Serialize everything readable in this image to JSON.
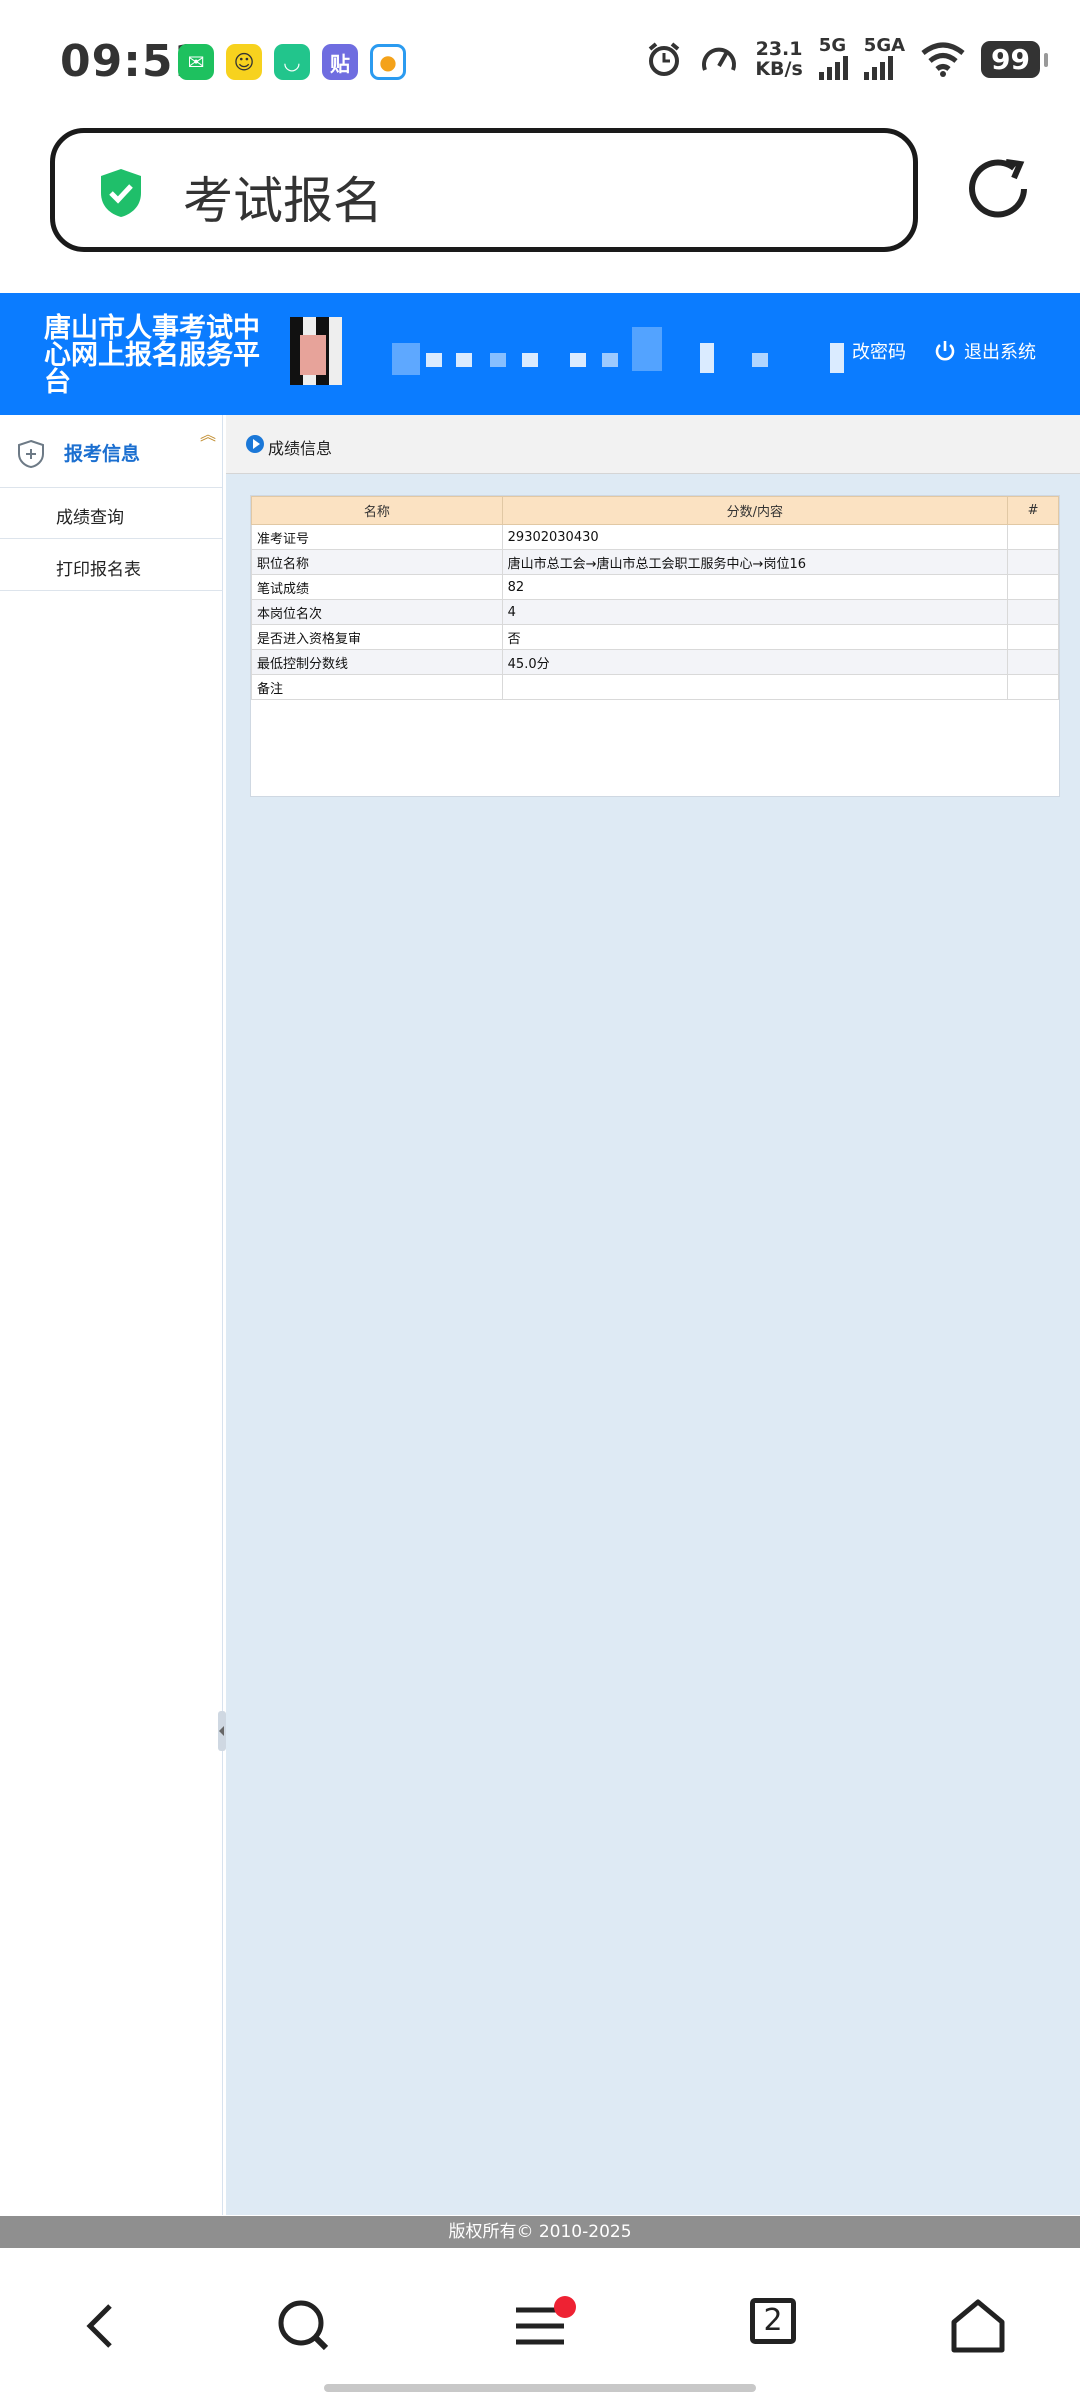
{
  "status_bar": {
    "time": "09:51",
    "app_icons": [
      "wechat-icon",
      "meituan-icon",
      "xianyu-icon",
      "tieba-icon",
      "browser-icon"
    ],
    "net_speed": "23.1",
    "net_speed_unit": "KB/s",
    "sim1": "5G",
    "sim2": "5GA",
    "battery": "99"
  },
  "browser": {
    "page_label": "考试报名"
  },
  "site": {
    "title": "唐山市人事考试中心网上报名服务平台",
    "change_password": "改密码",
    "logout": "退出系统"
  },
  "sidebar": {
    "group_label": "报考信息",
    "items": [
      {
        "label": "成绩查询"
      },
      {
        "label": "打印报名表"
      }
    ]
  },
  "content": {
    "section_title": "成绩信息",
    "table": {
      "headers": [
        "名称",
        "分数/内容",
        "#"
      ],
      "rows": [
        {
          "name": "准考证号",
          "value": "29302030430"
        },
        {
          "name": "职位名称",
          "value": "唐山市总工会→唐山市总工会职工服务中心→岗位16"
        },
        {
          "name": "笔试成绩",
          "value": "82"
        },
        {
          "name": "本岗位名次",
          "value": "4"
        },
        {
          "name": "是否进入资格复审",
          "value": "否"
        },
        {
          "name": "最低控制分数线",
          "value": "45.0分"
        },
        {
          "name": "备注",
          "value": ""
        }
      ]
    }
  },
  "footer": {
    "copyright": "版权所有© 2010-2025"
  },
  "bottom_nav": {
    "tab_count": "2"
  },
  "colors": {
    "header_blue": "#0b7cff",
    "content_bg": "#deeaf4",
    "table_head": "#fbe2c2",
    "badge_red": "#ee2233",
    "shield_green": "#1fbf6a"
  }
}
